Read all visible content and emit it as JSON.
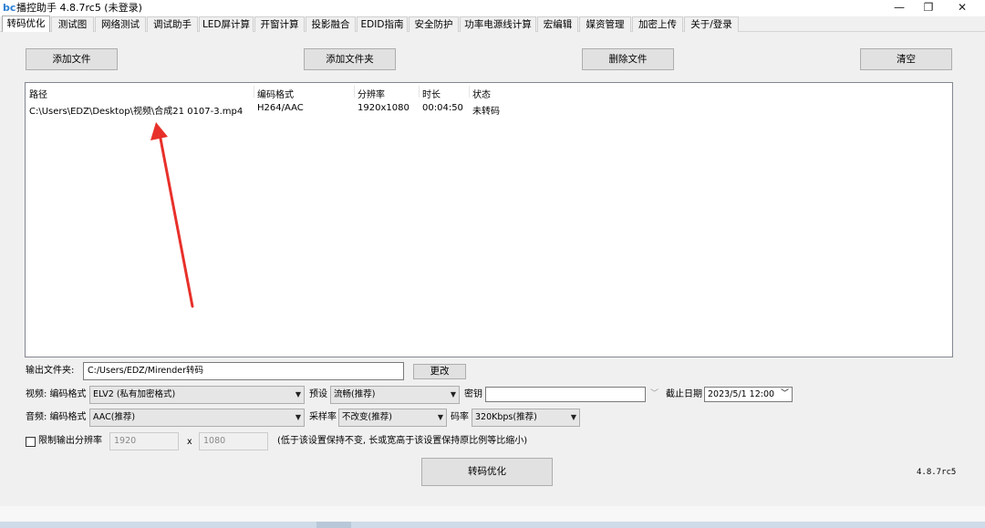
{
  "window": {
    "title": "播控助手 4.8.7rc5 (未登录)",
    "logo": "bc",
    "controls": {
      "minimize": "—",
      "maximize": "❐",
      "close": "✕"
    }
  },
  "tabs": [
    "转码优化",
    "测试图",
    "网络测试",
    "调试助手",
    "LED屏计算",
    "开窗计算",
    "投影融合",
    "EDID指南",
    "安全防护",
    "功率电源线计算",
    "宏编辑",
    "媒资管理",
    "加密上传",
    "关于/登录"
  ],
  "toolbar": {
    "add_file": "添加文件",
    "add_folder": "添加文件夹",
    "delete_file": "删除文件",
    "clear": "清空"
  },
  "file_list": {
    "columns": [
      "路径",
      "编码格式",
      "分辨率",
      "时长",
      "状态"
    ],
    "rows": [
      {
        "path": "C:\\Users\\EDZ\\Desktop\\视频\\合成21 0107-3.mp4",
        "codec": "H264/AAC",
        "resolution": "1920x1080",
        "duration": "00:04:50",
        "status": "未转码"
      }
    ]
  },
  "output": {
    "label": "输出文件夹:",
    "path": "C:/Users/EDZ/Mirender转码",
    "change_button": "更改"
  },
  "video": {
    "label": "视频: 编码格式",
    "codec": "ELV2 (私有加密格式)",
    "preset_label": "预设",
    "preset": "流畅(推荐)",
    "key_label": "密钥",
    "key": "",
    "expiry_label": "截止日期",
    "expiry": "2023/5/1 12:00"
  },
  "audio": {
    "label": "音频: 编码格式",
    "codec": "AAC(推荐)",
    "samplerate_label": "采样率",
    "samplerate": "不改变(推荐)",
    "bitrate_label": "码率",
    "bitrate": "320Kbps(推荐)"
  },
  "resolution_limit": {
    "label": "限制输出分辨率",
    "width": "1920",
    "x": "x",
    "height": "1080",
    "hint": "(低于该设置保持不变, 长或宽高于该设置保持原比例等比缩小)"
  },
  "action": {
    "convert": "转码优化"
  },
  "version": "4.8.7rc5",
  "colors": {
    "annotation_arrow": "#e8302a",
    "accent": "#2a7fd4"
  }
}
